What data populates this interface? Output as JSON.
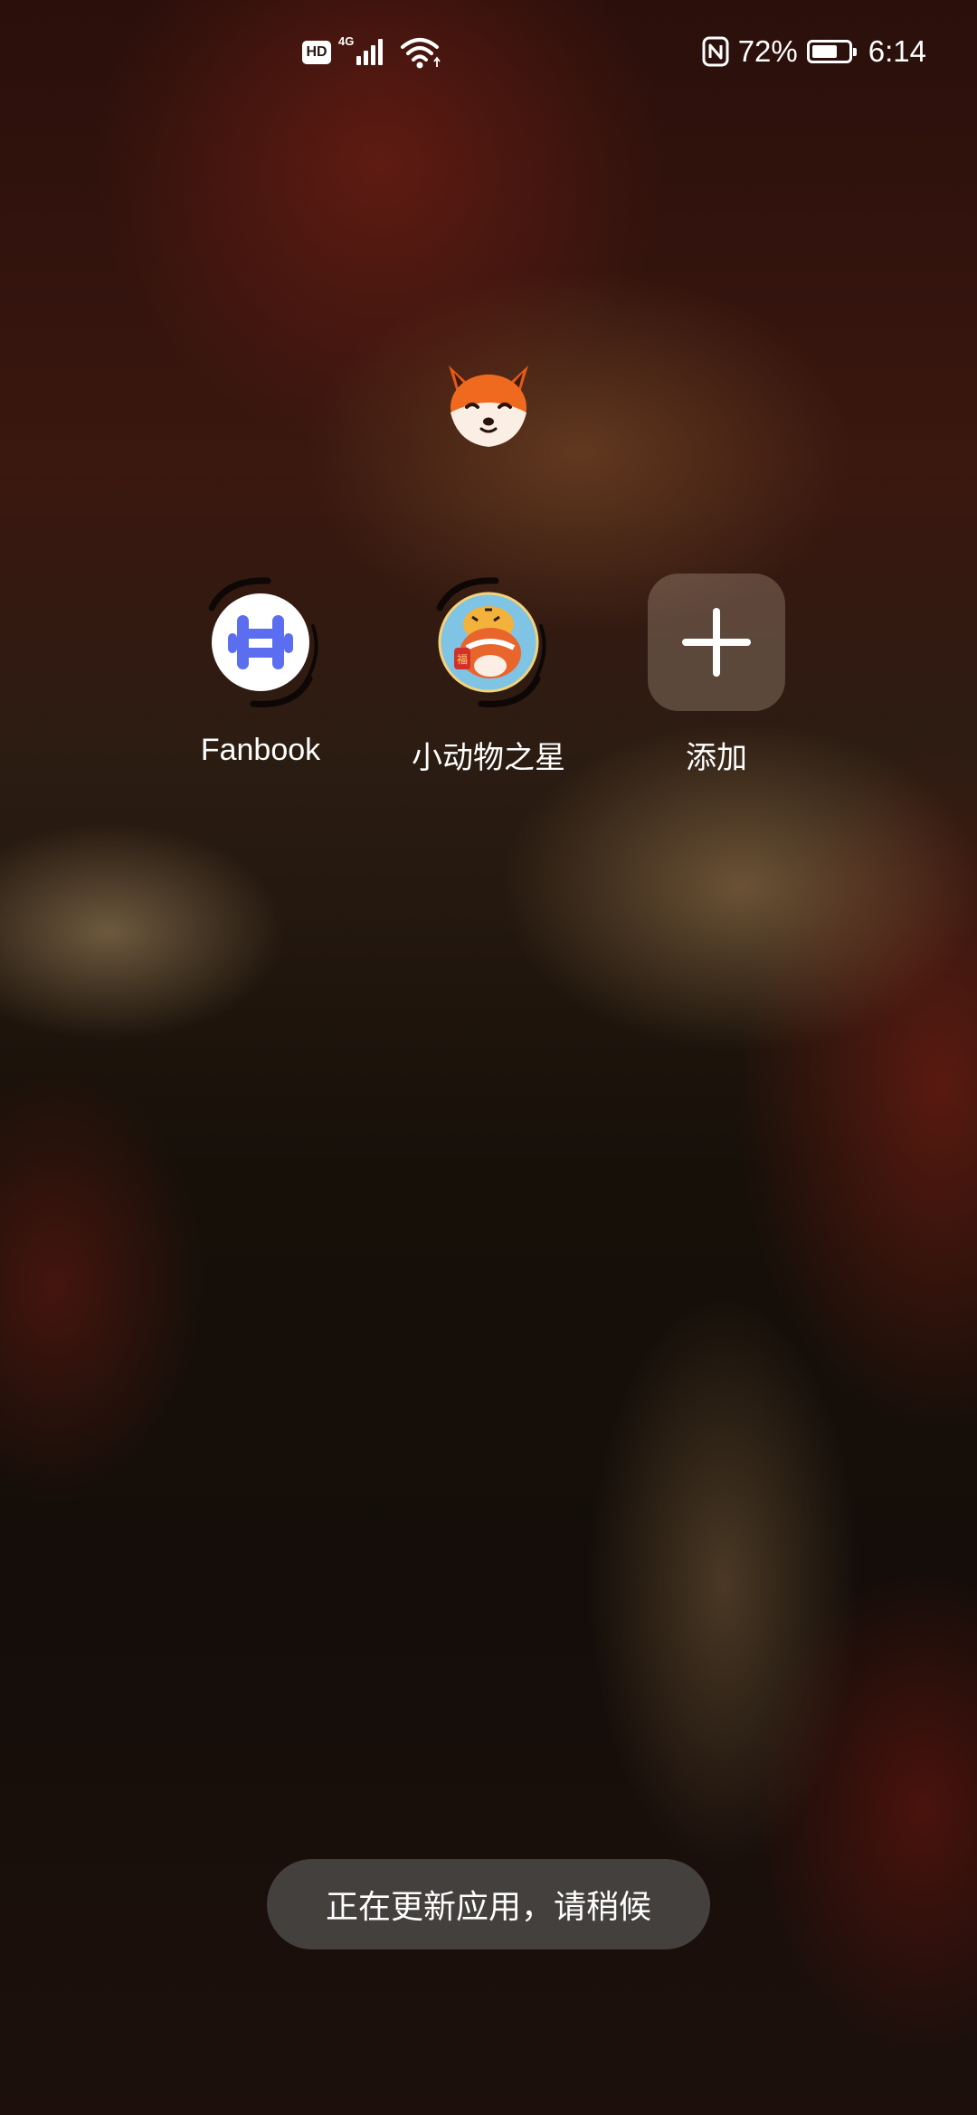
{
  "status_bar": {
    "hd_label": "HD",
    "network_label": "4G",
    "battery_percent": "72%",
    "battery_level": 0.72,
    "time": "6:14",
    "icons": [
      "hd-icon",
      "signal-icon",
      "wifi-icon",
      "nfc-icon",
      "battery-icon"
    ]
  },
  "folder": {
    "avatar_icon": "fox-icon",
    "apps": [
      {
        "label": "Fanbook",
        "icon": "fanbook-icon",
        "accent": "#5b6ef0"
      },
      {
        "label": "小动物之星",
        "icon": "animal-star-icon",
        "accent": "#e8652c"
      }
    ],
    "add_label": "添加",
    "add_icon": "plus-icon"
  },
  "toast": {
    "text": "正在更新应用，请稍候"
  }
}
